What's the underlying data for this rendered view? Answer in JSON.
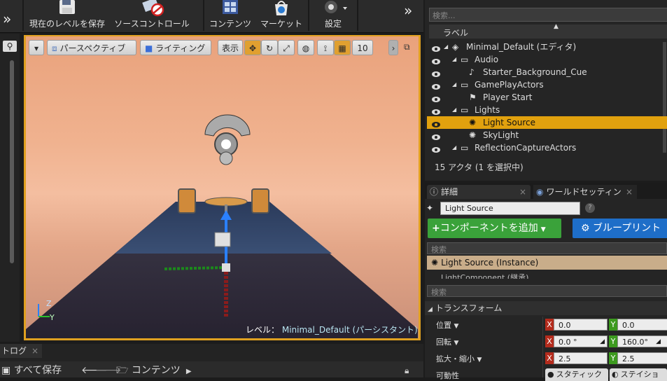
{
  "toolbar": {
    "save_level": "現在のレベルを保存",
    "source_control": "ソースコントロール",
    "content": "コンテンツ",
    "market": "マーケット",
    "settings": "設定"
  },
  "viewport": {
    "perspective": "パースペクティブ",
    "lighting": "ライティング",
    "show": "表示",
    "grid_size": "10",
    "level_prefix": "レベル：",
    "level_name": "Minimal_Default (パーシスタント)"
  },
  "outliner": {
    "search_placeholder": "検索...",
    "column_label": "ラベル",
    "items": [
      {
        "label": "Minimal_Default (エディタ)",
        "depth": 0,
        "kind": "world"
      },
      {
        "label": "Audio",
        "depth": 1,
        "kind": "folder"
      },
      {
        "label": "Starter_Background_Cue",
        "depth": 2,
        "kind": "sound"
      },
      {
        "label": "GamePlayActors",
        "depth": 1,
        "kind": "folder"
      },
      {
        "label": "Player Start",
        "depth": 2,
        "kind": "player"
      },
      {
        "label": "Lights",
        "depth": 1,
        "kind": "folder"
      },
      {
        "label": "Light Source",
        "depth": 2,
        "kind": "light",
        "selected": true
      },
      {
        "label": "SkyLight",
        "depth": 2,
        "kind": "light"
      },
      {
        "label": "ReflectionCaptureActors",
        "depth": 1,
        "kind": "folder"
      }
    ],
    "status": "15 アクタ (1 を選択中)"
  },
  "details": {
    "tab_details": "詳細",
    "tab_world": "ワールドセッティン",
    "name_value": "Light Source",
    "add_component": "コンポーネントを追加",
    "blueprint": "ブループリント",
    "component_search": "検索",
    "instance_label": "Light Source (Instance)",
    "component_child": "LightComponent (継承)",
    "property_search": "検索",
    "transform_header": "トランスフォーム",
    "location_label": "位置",
    "rotation_label": "回転",
    "scale_label": "拡大・縮小",
    "mobility_label": "可動性",
    "location": {
      "x": "0.0",
      "y": "0.0"
    },
    "rotation": {
      "x": "0.0 °",
      "y": "160.0°"
    },
    "scale": {
      "x": "2.5",
      "y": "2.5"
    },
    "mobility_static": "スタティック",
    "mobility_stationary": "ステイショ"
  },
  "bottom": {
    "log_tab": "トログ",
    "save_all": "すべて保存",
    "content_path": "コンテンツ"
  },
  "colors": {
    "selection": "#e1a10e",
    "add_component_green": "#3aa23a",
    "blueprint_blue": "#1e6ec8",
    "instance_tan": "#c9ad8a"
  }
}
